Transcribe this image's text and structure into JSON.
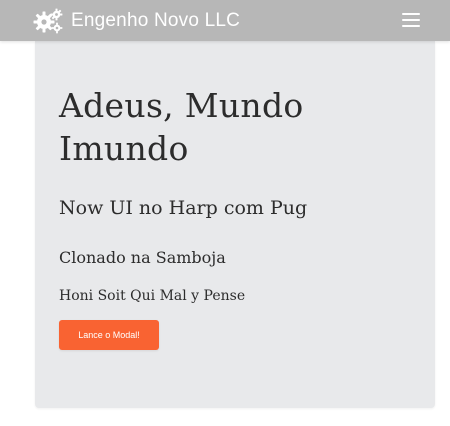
{
  "navbar": {
    "brand_name": "Engenho Novo LLC",
    "brand_icon": "gears-icon",
    "menu_icon": "hamburger-menu-icon",
    "background": "#b7b7b7"
  },
  "jumbotron": {
    "title": "Adeus, Mundo Imundo",
    "subtitle": "Now UI no Harp com Pug",
    "line3": "Clonado na Samboja",
    "line4": "Honi Soit Qui Mal y Pense",
    "button_label": "Lance o Modal!",
    "button_color": "#f96332",
    "background": "#e8e9eb"
  }
}
